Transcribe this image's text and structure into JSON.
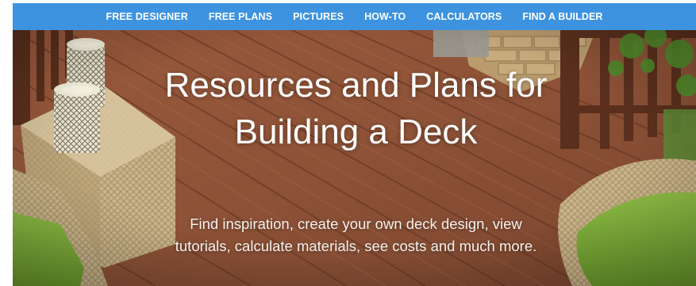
{
  "nav": {
    "items": [
      {
        "label": "FREE DESIGNER"
      },
      {
        "label": "FREE PLANS"
      },
      {
        "label": "PICTURES"
      },
      {
        "label": "HOW-TO"
      },
      {
        "label": "CALCULATORS"
      },
      {
        "label": "FIND A BUILDER"
      }
    ]
  },
  "hero": {
    "title": "Resources and Plans for Building a Deck",
    "subtitle": "Find inspiration, create your own deck design, view tutorials, calculate materials, see costs and much more."
  },
  "colors": {
    "nav_background": "#3d93e0",
    "deck_wood": "#8a4f34",
    "cushion_green": "#7fae3b",
    "wicker": "#c9b48c"
  }
}
